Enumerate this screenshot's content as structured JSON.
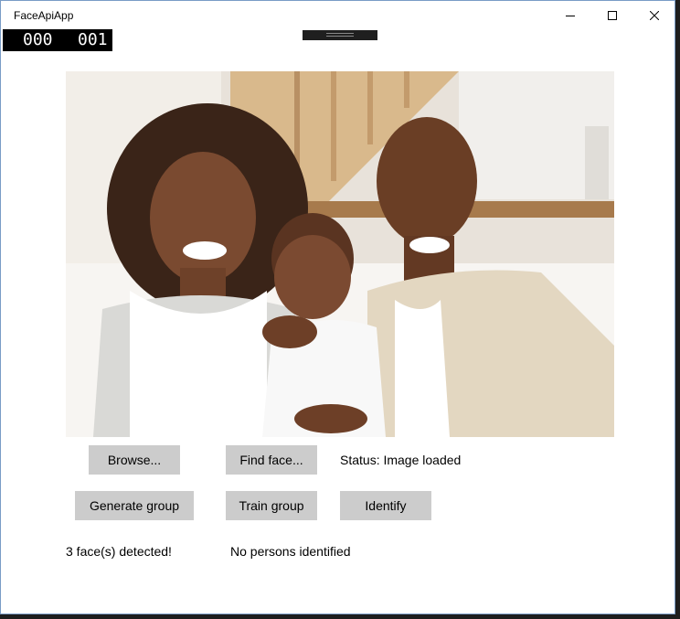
{
  "window": {
    "title": "FaceApiApp"
  },
  "frame_counter": {
    "left": "000",
    "right": "001"
  },
  "photo": {
    "description_icon": "photo-image"
  },
  "buttons": {
    "browse": "Browse...",
    "find_face": "Find face...",
    "generate_group": "Generate group",
    "train_group": "Train group",
    "identify": "Identify"
  },
  "status": {
    "text": "Status: Image loaded"
  },
  "results": {
    "faces": "3 face(s) detected!",
    "persons": "No persons identified"
  },
  "colors": {
    "button_bg": "#cccccc",
    "window_bg": "#ffffff",
    "counter_bg": "#000000"
  }
}
